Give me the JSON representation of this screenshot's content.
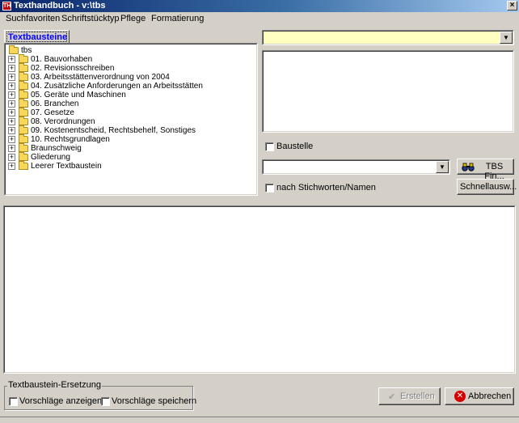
{
  "window": {
    "title": "Texthandbuch  -  v:\\tbs",
    "app_icon_text": "TH",
    "close_glyph": "×"
  },
  "menu": [
    "Suchfavoriten",
    "Schriftstücktyp",
    "Pflege",
    "Formatierung"
  ],
  "tab": {
    "label": "Textbausteine"
  },
  "tree": {
    "root": "tbs",
    "items": [
      "01. Bauvorhaben",
      "02. Revisionsschreiben",
      "03. Arbeitsstättenverordnung von 2004",
      "04. Zusätzliche Anforderungen an Arbeitsstätten",
      "05. Geräte und Maschinen",
      "06. Branchen",
      "07. Gesetze",
      "08. Verordnungen",
      "09. Kostenentscheid, Rechtsbehelf, Sonstiges",
      "10. Rechtsgrundlagen",
      "Braunschweig",
      "Gliederung",
      "Leerer Textbaustein"
    ]
  },
  "right_panel": {
    "top_combo_value": "",
    "baustelle_label": "Baustelle",
    "search_combo_value": "",
    "tbs_find_label": "TBS Fin...",
    "stichworten_label": "nach Stichworten/Namen",
    "schnellauswahl_label": "Schnellausw..."
  },
  "bottom": {
    "group_title": "Textbaustein-Ersetzung",
    "vorschlaege_anzeigen": "Vorschläge anzeigen",
    "vorschlaege_speichern": "Vorschläge speichern",
    "erstellen_label": "Erstellen",
    "abbrechen_label": "Abbrechen"
  },
  "colors": {
    "combo_yellow": "#ffffc0",
    "tab_text": "#0000ff",
    "abbrechen_icon": "#d40000"
  }
}
